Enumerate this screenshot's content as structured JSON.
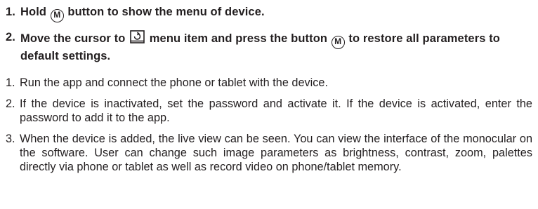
{
  "icons": {
    "menu_button": "m-circle-icon",
    "restore_defaults": "restore-defaults-icon"
  },
  "menu_icon_letter": "M",
  "bold_steps": [
    {
      "number": "1.",
      "before_icon": "Hold ",
      "after_icon": " button to show the menu of device."
    },
    {
      "number": "2.",
      "part1": "Move the cursor to ",
      "part2": " menu item and press the button ",
      "part3": " to restore all parameters to default settings."
    }
  ],
  "plain_steps": [
    {
      "number": "1.",
      "text": "Run the app and connect the phone or tablet with the device."
    },
    {
      "number": "2.",
      "text": "If the device is inactivated, set the password and activate it. If the device is activated, enter the password to add it to the app."
    },
    {
      "number": "3.",
      "text": "When the device is added, the live view can be seen. You can view the interface of the monocular on the software. User can change such image parameters as brightness, contrast, zoom, palettes directly via phone or tablet as well as record video on phone/tablet memory."
    }
  ]
}
